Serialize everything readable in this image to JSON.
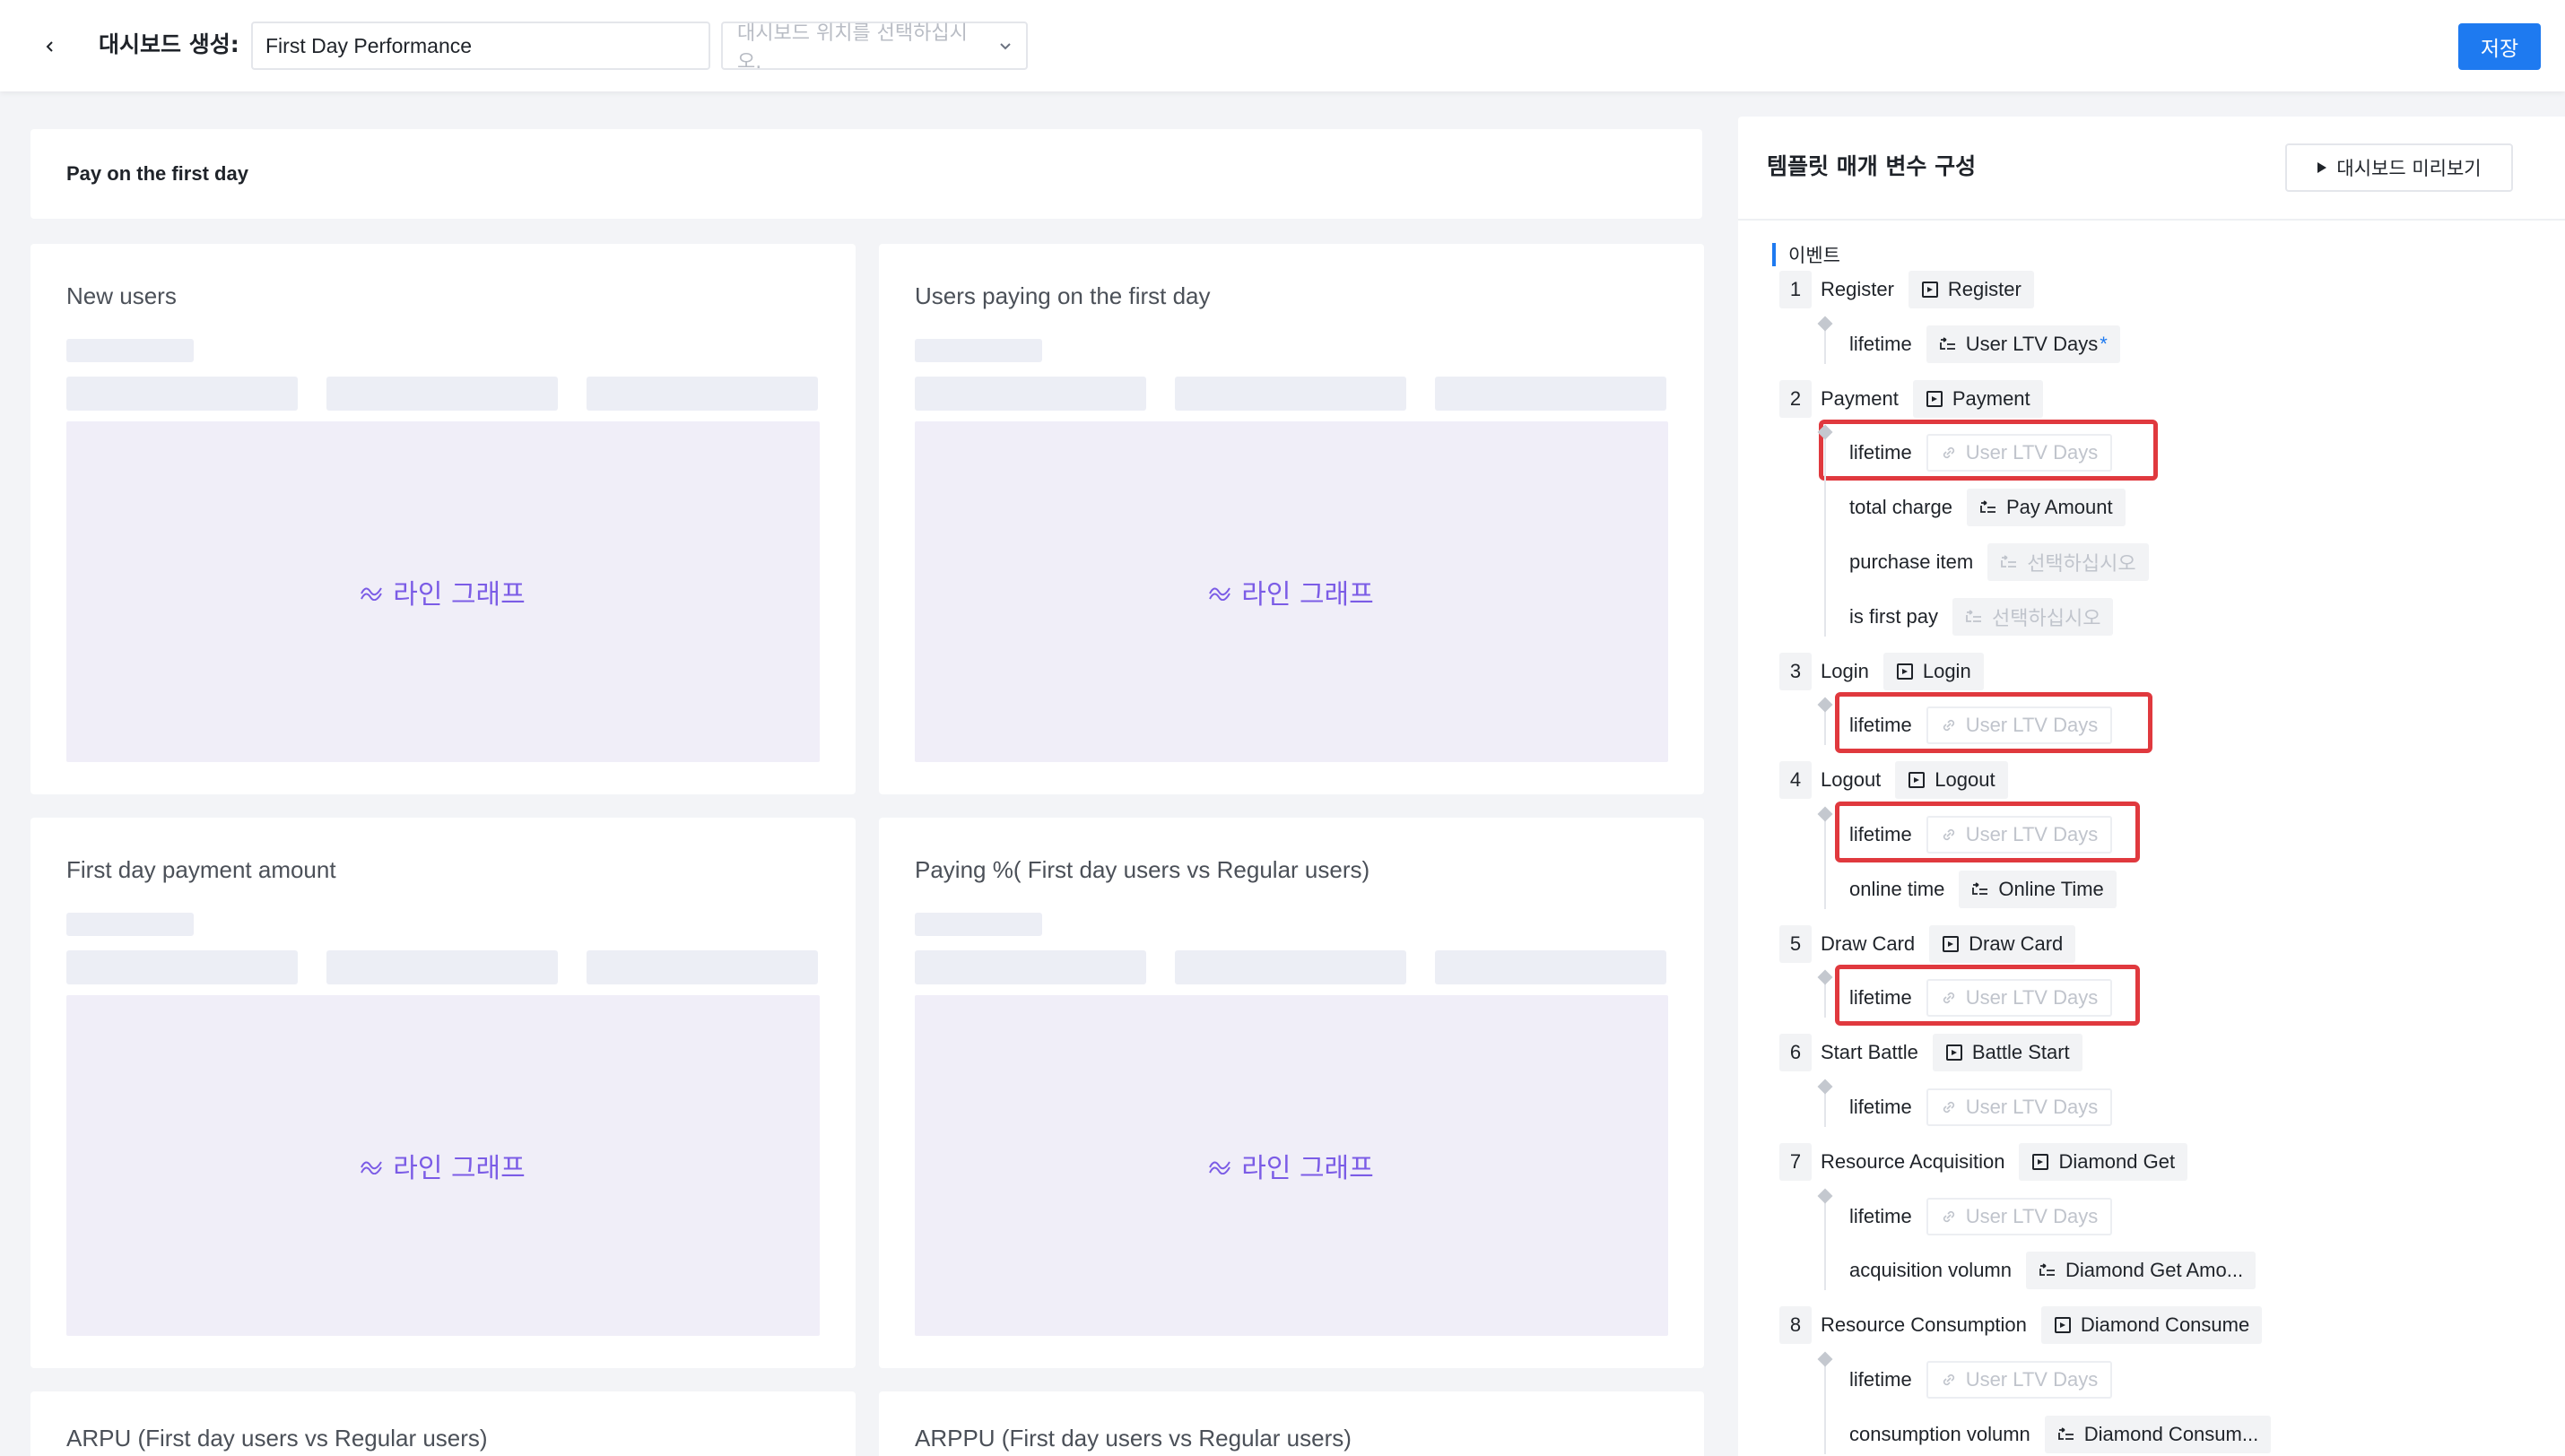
{
  "header": {
    "label": "대시보드 생성:",
    "dashboard_name": "First Day Performance",
    "location_placeholder": "대시보드 위치를 선택하십시오.",
    "save_label": "저장"
  },
  "section": {
    "title": "Pay on the first day"
  },
  "chart_placeholder": "라인 그래프",
  "cards": [
    {
      "title": "New users"
    },
    {
      "title": "Users paying on the first day"
    },
    {
      "title": "First day payment amount"
    },
    {
      "title": "Paying %( First day users vs Regular users)"
    },
    {
      "title": "ARPU (First day users vs Regular users)"
    },
    {
      "title": "ARPPU (First day users vs Regular users)"
    }
  ],
  "panel": {
    "title": "템플릿 매개 변수 구성",
    "preview_label": "대시보드 미리보기",
    "events_heading": "이벤트",
    "events": [
      {
        "num": "1",
        "name": "Register",
        "event": "Register",
        "params": [
          {
            "name": "lifetime",
            "value": "User LTV Days",
            "required": "*",
            "state": "set"
          }
        ]
      },
      {
        "num": "2",
        "name": "Payment",
        "event": "Payment",
        "params": [
          {
            "name": "lifetime",
            "value": "User LTV Days",
            "state": "placeholder",
            "highlighted": true
          },
          {
            "name": "total charge",
            "value": "Pay Amount",
            "state": "set"
          },
          {
            "name": "purchase item",
            "value": "선택하십시오",
            "state": "placeholder-select"
          },
          {
            "name": "is first pay",
            "value": "선택하십시오",
            "state": "placeholder-select"
          }
        ]
      },
      {
        "num": "3",
        "name": "Login",
        "event": "Login",
        "params": [
          {
            "name": "lifetime",
            "value": "User LTV Days",
            "state": "placeholder",
            "highlighted": true
          }
        ]
      },
      {
        "num": "4",
        "name": "Logout",
        "event": "Logout",
        "params": [
          {
            "name": "lifetime",
            "value": "User LTV Days",
            "state": "placeholder",
            "highlighted": true
          },
          {
            "name": "online time",
            "value": "Online Time",
            "state": "set"
          }
        ]
      },
      {
        "num": "5",
        "name": "Draw Card",
        "event": "Draw Card",
        "params": [
          {
            "name": "lifetime",
            "value": "User LTV Days",
            "state": "placeholder",
            "highlighted": true
          }
        ]
      },
      {
        "num": "6",
        "name": "Start Battle",
        "event": "Battle Start",
        "params": [
          {
            "name": "lifetime",
            "value": "User LTV Days",
            "state": "placeholder"
          }
        ]
      },
      {
        "num": "7",
        "name": "Resource Acquisition",
        "event": "Diamond Get",
        "params": [
          {
            "name": "lifetime",
            "value": "User LTV Days",
            "state": "placeholder"
          },
          {
            "name": "acquisition volumn",
            "value": "Diamond Get Amo...",
            "state": "set"
          }
        ]
      },
      {
        "num": "8",
        "name": "Resource Consumption",
        "event": "Diamond Consume",
        "params": [
          {
            "name": "lifetime",
            "value": "User LTV Days",
            "state": "placeholder"
          },
          {
            "name": "consumption volumn",
            "value": "Diamond Consum...",
            "state": "set"
          }
        ]
      }
    ]
  },
  "colors": {
    "accent": "#1e7af0",
    "highlight": "#e0393e",
    "chart_text": "#7b5ce6"
  }
}
